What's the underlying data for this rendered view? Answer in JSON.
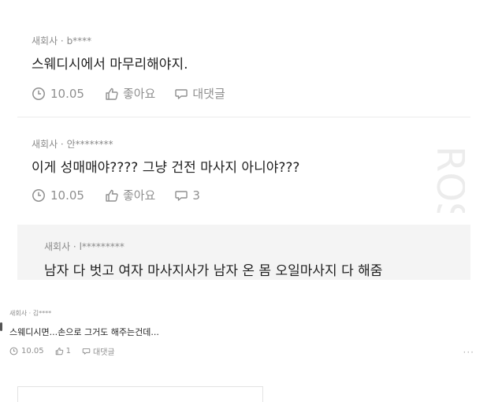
{
  "comments": [
    {
      "meta": "새회사 · b****",
      "body": "스웨디시에서 마무리해야지.",
      "date": "10.05",
      "like_label": "좋아요",
      "reply_label": "대댓글"
    },
    {
      "meta": "새회사 · 안********",
      "body": "이게 성매매야???? 그냥 건전 마사지 아니야???",
      "date": "10.05",
      "like_label": "좋아요",
      "reply_label": "3"
    },
    {
      "meta": "새회사 · l*********",
      "body": "남자 다 벗고 여자 마사지사가 남자 온 몸 오일마사지 다 해줌"
    },
    {
      "meta": "새회사 · 김****",
      "body": "스웨디시면...손으로 그거도 해주는건데...",
      "date": "10.05",
      "like_label": "1",
      "reply_label": "대댓글",
      "more": "···"
    }
  ]
}
